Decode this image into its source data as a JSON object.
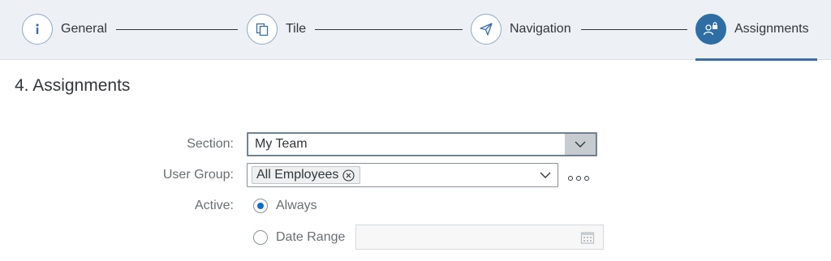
{
  "wizard": {
    "steps": [
      {
        "label": "General",
        "icon": "info-icon",
        "state": "completed"
      },
      {
        "label": "Tile",
        "icon": "tile-copy-icon",
        "state": "completed"
      },
      {
        "label": "Navigation",
        "icon": "paper-plane-icon",
        "state": "completed"
      },
      {
        "label": "Assignments",
        "icon": "user-lock-icon",
        "state": "active"
      }
    ],
    "accent_color": "#2f6ea5"
  },
  "page": {
    "title": "4. Assignments"
  },
  "form": {
    "section": {
      "label": "Section:",
      "value": "My Team"
    },
    "user_group": {
      "label": "User Group:",
      "tokens": [
        "All Employees"
      ]
    },
    "active": {
      "label": "Active:",
      "options": [
        {
          "label": "Always",
          "selected": true
        },
        {
          "label": "Date Range",
          "selected": false
        }
      ],
      "date_range_value": ""
    }
  }
}
